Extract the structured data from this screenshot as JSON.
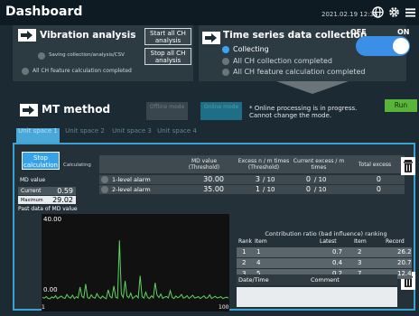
{
  "header": {
    "title": "Dashboard",
    "datetime": "2021.02.19 12:36"
  },
  "vibration": {
    "title": "Vibration analysis",
    "start_all": "Start all CH analysis",
    "stop_all": "Stop all CH analysis",
    "status_saving": "Saving collection/analysis/CSV",
    "status_feature": "All CH feature calculation completed"
  },
  "timeseries": {
    "title": "Time series data collection",
    "status_collecting": "Collecting",
    "status_collection_done": "All CH collection completed",
    "status_feature_done": "All CH feature calculation completed",
    "toggle_off": "OFF",
    "toggle_on": "ON",
    "toggle_state": "on"
  },
  "mt": {
    "title": "MT method",
    "offline_mode": "Offline mode",
    "online_mode": "Online mode",
    "note": "* Online processing is in progress. Cannot change the mode.",
    "run": "Run",
    "tabs": [
      "Unit space 1",
      "Unit space 2",
      "Unit space 3",
      "Unit space 4"
    ]
  },
  "panel": {
    "stop_calc": "Stop calculation",
    "calculating": "Calculating",
    "md_label": "MD value",
    "current_label": "Current",
    "current_value": "0.59",
    "max_label": "Maximum",
    "max_value": "29.02",
    "past_label": "Past data of MD value",
    "alarm_headers": {
      "md_threshold": "MD value (Threshold)",
      "excess": "Excess n / m times (Threshold)",
      "current_excess": "Current excess / m times",
      "total_excess": "Total excess"
    },
    "alarms": [
      {
        "label": "1-level alarm",
        "md": "30.00",
        "n": "3",
        "m": "10",
        "cur": "0",
        "cur_m": "10",
        "total": "0"
      },
      {
        "label": "2-level alarm",
        "md": "35.00",
        "n": "1",
        "m": "10",
        "cur": "0",
        "cur_m": "10",
        "total": "0"
      }
    ]
  },
  "ranking": {
    "title": "Contribution ratio (bad influence) ranking",
    "headers": [
      "Rank",
      "Item",
      "Latest",
      "Item",
      "Record"
    ],
    "rows": [
      [
        "1",
        "1",
        "0.7",
        "2",
        "26.2"
      ],
      [
        "2",
        "4",
        "0.4",
        "3",
        "20.7"
      ],
      [
        "3",
        "5",
        "0.2",
        "7",
        "12.4"
      ]
    ]
  },
  "comments": {
    "date_header": "Date/Time",
    "comment_header": "Comment"
  },
  "chart_data": {
    "type": "line",
    "title": "",
    "xlabel": "",
    "ylabel": "",
    "xlim": [
      1,
      100
    ],
    "ylim": [
      0,
      40
    ],
    "x_ticks": [
      "1",
      "100"
    ],
    "y_ticks": [
      "40.00",
      "0.00"
    ],
    "grid": false,
    "series": [
      {
        "color": "#5fd35f",
        "values": [
          1.5,
          1.2,
          2.0,
          1.1,
          0.9,
          1.8,
          1.3,
          2.4,
          1.0,
          1.6,
          2.2,
          1.4,
          1.1,
          3.0,
          1.7,
          1.2,
          2.6,
          1.0,
          1.9,
          1.3,
          6.5,
          2.1,
          1.4,
          8.0,
          1.6,
          1.0,
          2.8,
          1.5,
          1.2,
          3.4,
          1.8,
          1.1,
          2.2,
          1.4,
          0.9,
          5.2,
          2.0,
          1.3,
          7.1,
          1.6,
          1.2,
          29.0,
          3.0,
          1.5,
          9.5,
          2.2,
          1.4,
          3.6,
          1.0,
          1.8,
          2.5,
          1.3,
          12.0,
          2.0,
          1.2,
          4.1,
          1.6,
          1.0,
          2.3,
          1.4,
          8.6,
          2.7,
          1.5,
          3.2,
          1.1,
          1.7,
          2.0,
          1.3,
          4.8,
          1.6,
          1.0,
          2.2,
          1.4,
          1.9,
          3.0,
          1.2,
          1.6,
          2.4,
          1.1,
          1.8,
          2.6,
          1.3,
          1.5,
          2.0,
          1.0,
          1.7,
          2.3,
          1.2,
          1.4,
          2.8,
          1.1,
          1.6,
          2.1,
          1.3,
          1.5,
          1.9,
          1.0,
          1.4,
          1.7,
          1.2
        ]
      }
    ]
  }
}
